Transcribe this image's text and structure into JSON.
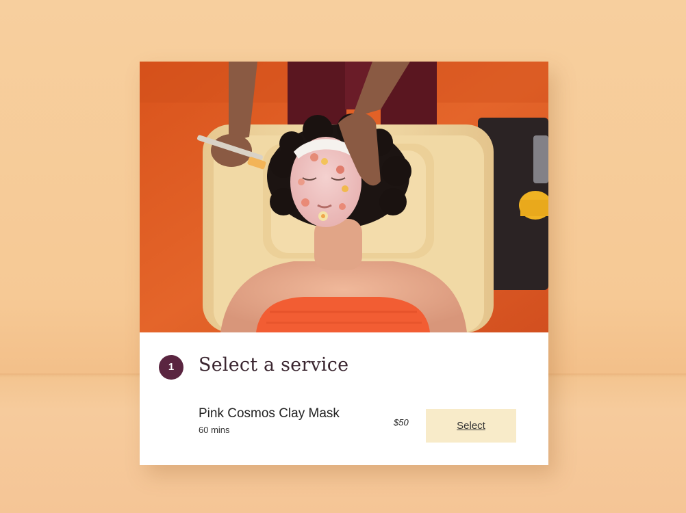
{
  "step": {
    "number": "1",
    "title": "Select a service"
  },
  "service": {
    "name": "Pink Cosmos Clay Mask",
    "duration": "60 mins",
    "price": "$50",
    "select_label": "Select"
  },
  "colors": {
    "background": "#f7cf9e",
    "accent": "#5a2540",
    "button": "#f8ebc9"
  }
}
